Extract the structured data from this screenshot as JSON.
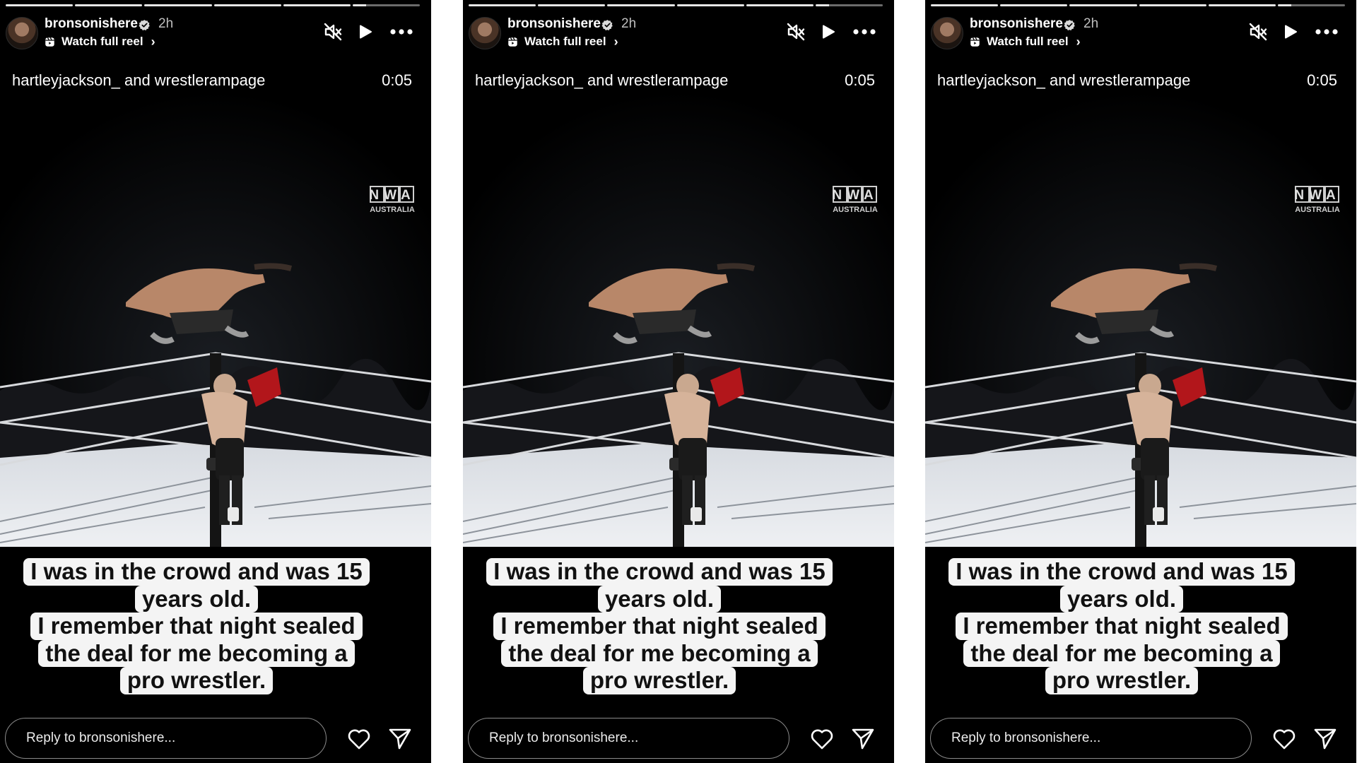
{
  "story": {
    "username": "bronsonishere",
    "time_ago": "2h",
    "reel_link": "Watch full reel",
    "collaborators": "hartleyjackson_ and wrestlerampage",
    "duration": "0:05",
    "watermark_top": "NWA",
    "watermark_bottom": "AUSTRALIA",
    "caption_lines": [
      "I was in the crowd and was 15",
      "years old.",
      "I remember that night sealed",
      "the deal for me becoming a",
      "pro wrestler."
    ],
    "reply_placeholder": "Reply to bronsonishere...",
    "progress_segments": 6,
    "progress_current_segment": 6,
    "progress_current_fraction": 0.2,
    "icons": [
      "verified-badge-icon",
      "reel-icon",
      "chevron-right-icon",
      "muted-speaker-icon",
      "play-icon",
      "more-options-icon",
      "heart-icon",
      "send-icon"
    ]
  },
  "colors": {
    "background": "#000000",
    "text": "#ffffff",
    "caption_bg": "#f4f4f4",
    "caption_text": "#111111",
    "divider": "#ffffff"
  }
}
